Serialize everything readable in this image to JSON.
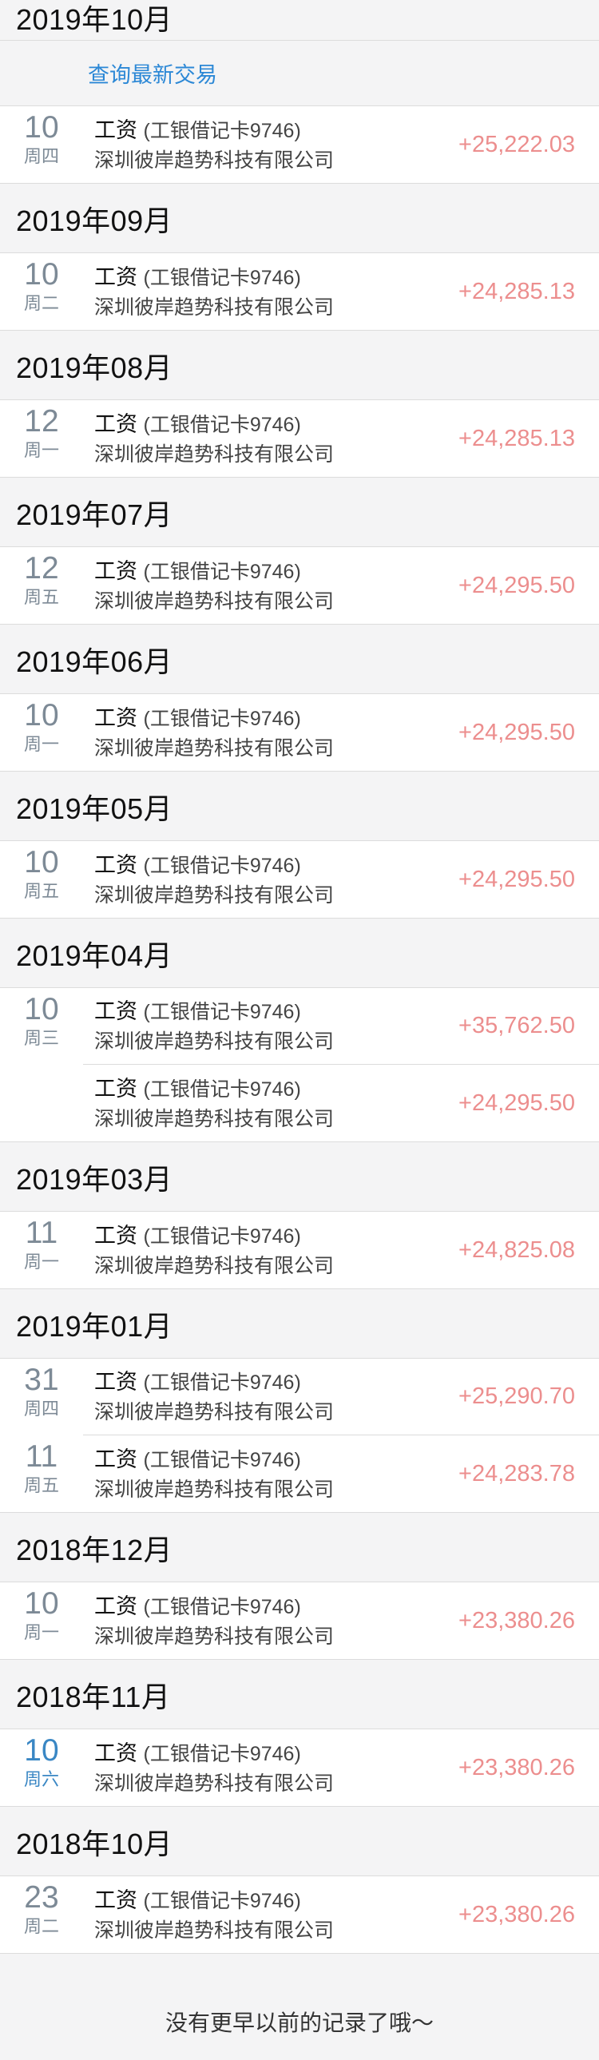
{
  "query_latest": "查询最新交易",
  "months": [
    {
      "title": "2019年10月",
      "transactions": [
        {
          "day": "10",
          "weekday": "周四",
          "title": "工资",
          "card": "(工银借记卡9746)",
          "company": "深圳彼岸趋势科技有限公司",
          "amount": "+25,222.03"
        }
      ]
    },
    {
      "title": "2019年09月",
      "transactions": [
        {
          "day": "10",
          "weekday": "周二",
          "title": "工资",
          "card": "(工银借记卡9746)",
          "company": "深圳彼岸趋势科技有限公司",
          "amount": "+24,285.13"
        }
      ]
    },
    {
      "title": "2019年08月",
      "transactions": [
        {
          "day": "12",
          "weekday": "周一",
          "title": "工资",
          "card": "(工银借记卡9746)",
          "company": "深圳彼岸趋势科技有限公司",
          "amount": "+24,285.13"
        }
      ]
    },
    {
      "title": "2019年07月",
      "transactions": [
        {
          "day": "12",
          "weekday": "周五",
          "title": "工资",
          "card": "(工银借记卡9746)",
          "company": "深圳彼岸趋势科技有限公司",
          "amount": "+24,295.50"
        }
      ]
    },
    {
      "title": "2019年06月",
      "transactions": [
        {
          "day": "10",
          "weekday": "周一",
          "title": "工资",
          "card": "(工银借记卡9746)",
          "company": "深圳彼岸趋势科技有限公司",
          "amount": "+24,295.50"
        }
      ]
    },
    {
      "title": "2019年05月",
      "transactions": [
        {
          "day": "10",
          "weekday": "周五",
          "title": "工资",
          "card": "(工银借记卡9746)",
          "company": "深圳彼岸趋势科技有限公司",
          "amount": "+24,295.50"
        }
      ]
    },
    {
      "title": "2019年04月",
      "transactions": [
        {
          "day": "10",
          "weekday": "周三",
          "title": "工资",
          "card": "(工银借记卡9746)",
          "company": "深圳彼岸趋势科技有限公司",
          "amount": "+35,762.50"
        },
        {
          "day": "",
          "weekday": "",
          "title": "工资",
          "card": "(工银借记卡9746)",
          "company": "深圳彼岸趋势科技有限公司",
          "amount": "+24,295.50"
        }
      ]
    },
    {
      "title": "2019年03月",
      "transactions": [
        {
          "day": "11",
          "weekday": "周一",
          "title": "工资",
          "card": "(工银借记卡9746)",
          "company": "深圳彼岸趋势科技有限公司",
          "amount": "+24,825.08"
        }
      ]
    },
    {
      "title": "2019年01月",
      "transactions": [
        {
          "day": "31",
          "weekday": "周四",
          "title": "工资",
          "card": "(工银借记卡9746)",
          "company": "深圳彼岸趋势科技有限公司",
          "amount": "+25,290.70"
        },
        {
          "day": "11",
          "weekday": "周五",
          "title": "工资",
          "card": "(工银借记卡9746)",
          "company": "深圳彼岸趋势科技有限公司",
          "amount": "+24,283.78"
        }
      ]
    },
    {
      "title": "2018年12月",
      "transactions": [
        {
          "day": "10",
          "weekday": "周一",
          "title": "工资",
          "card": "(工银借记卡9746)",
          "company": "深圳彼岸趋势科技有限公司",
          "amount": "+23,380.26"
        }
      ]
    },
    {
      "title": "2018年11月",
      "transactions": [
        {
          "day": "10",
          "weekday": "周六",
          "title": "工资",
          "card": "(工银借记卡9746)",
          "company": "深圳彼岸趋势科技有限公司",
          "amount": "+23,380.26",
          "weekend": true
        }
      ]
    },
    {
      "title": "2018年10月",
      "transactions": [
        {
          "day": "23",
          "weekday": "周二",
          "title": "工资",
          "card": "(工银借记卡9746)",
          "company": "深圳彼岸趋势科技有限公司",
          "amount": "+23,380.26"
        }
      ]
    }
  ],
  "footer_text": "没有更早以前的记录了哦～",
  "colors": {
    "amount": "#ec8e8e",
    "link": "#2c88d6",
    "weekday": "#7d8a96",
    "weekend": "#3a87c4",
    "background": "#f4f4f5"
  }
}
